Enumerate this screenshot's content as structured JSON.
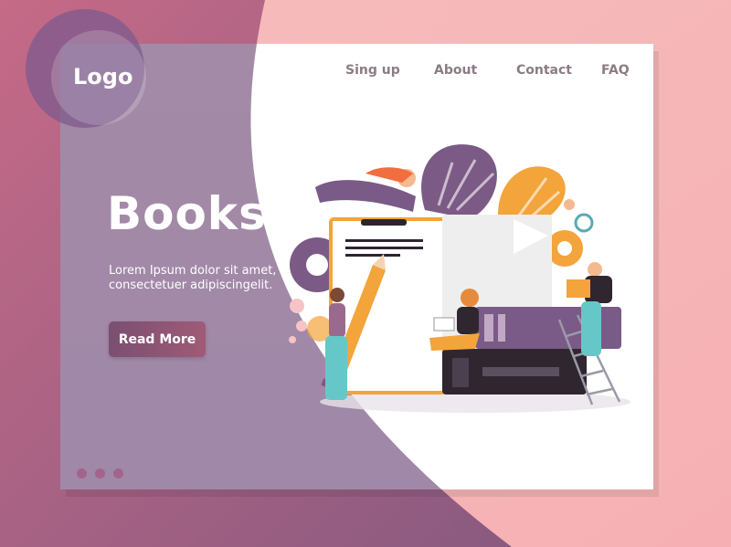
{
  "brand": {
    "logo_text": "Logo"
  },
  "nav": {
    "items": [
      {
        "label": "Sing up"
      },
      {
        "label": "About"
      },
      {
        "label": "Contact"
      },
      {
        "label": "FAQ"
      }
    ]
  },
  "hero": {
    "title": "Books",
    "description_line1": "Lorem Ipsum dolor sit amet,",
    "description_line2": "consectetuer adipiscingelit.",
    "cta_label": "Read More"
  },
  "pagination": {
    "dots": 3,
    "active_index": 0
  },
  "colors": {
    "page_left": "#c36a86",
    "page_right": "#f8c3c3",
    "card_white": "#ffffff",
    "overlay_purple": "#7a5a88",
    "accent_orange": "#f39a2a",
    "book_dark": "#3b2f3a",
    "dot": "#a3648c"
  },
  "illustration": {
    "elements": [
      "book-stack-illustration",
      "pencil-icon",
      "gear-icon",
      "monstera-leaf-icon",
      "ladder-icon",
      "reader-figure"
    ]
  }
}
